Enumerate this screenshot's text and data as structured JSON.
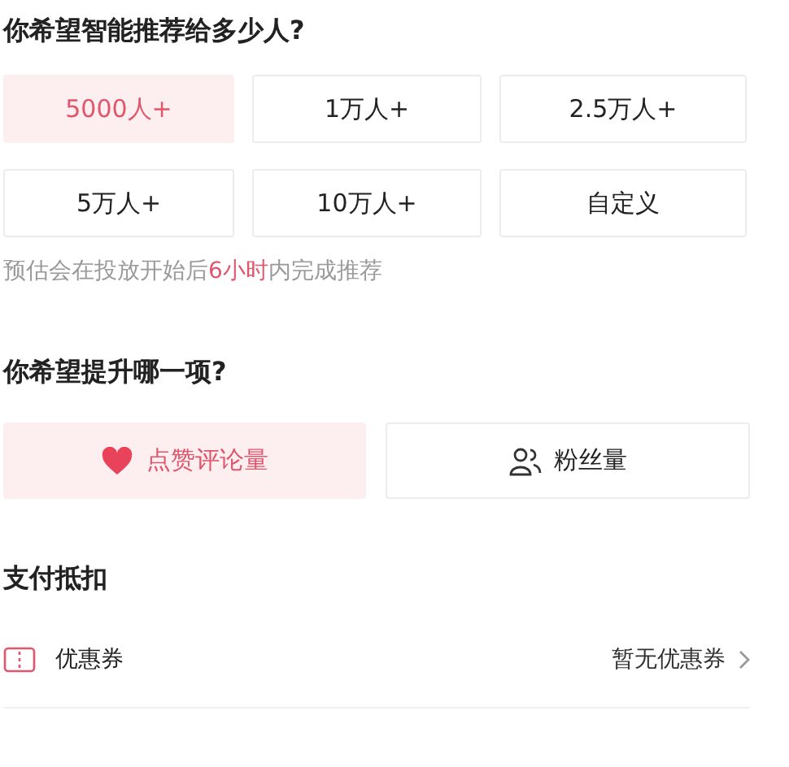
{
  "audience": {
    "title": "你希望智能推荐给多少人?",
    "options": [
      {
        "label": "5000人+",
        "selected": true
      },
      {
        "label": "1万人+",
        "selected": false
      },
      {
        "label": "2.5万人+",
        "selected": false
      },
      {
        "label": "5万人+",
        "selected": false
      },
      {
        "label": "10万人+",
        "selected": false
      },
      {
        "label": "自定义",
        "selected": false
      }
    ],
    "note": "预估会在投放开始后**6小时**内完成推荐"
  },
  "goal": {
    "title": "你希望提升哪一项?",
    "options": [
      {
        "kind": "likes",
        "label": "点赞评论量",
        "selected": true
      },
      {
        "kind": "fans",
        "label": "粉丝量",
        "selected": false
      }
    ]
  },
  "payment": {
    "title": "支付抵扣",
    "rows": [
      {
        "label": "优惠券",
        "value": "暂无优惠券"
      }
    ]
  }
}
